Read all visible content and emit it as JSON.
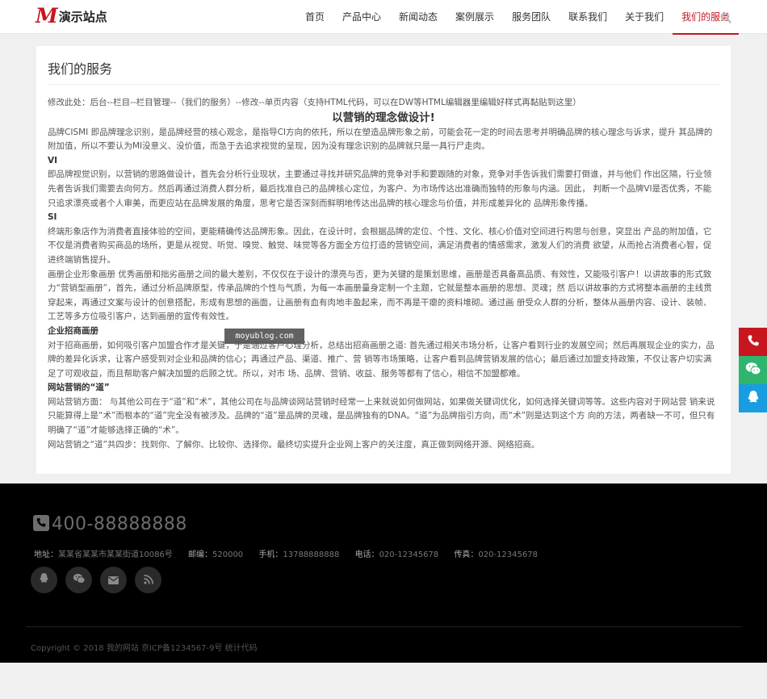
{
  "header": {
    "logo_mark": "M",
    "logo_text": "演示站点",
    "nav": [
      {
        "label": "首页"
      },
      {
        "label": "产品中心"
      },
      {
        "label": "新闻动态"
      },
      {
        "label": "案例展示"
      },
      {
        "label": "服务团队"
      },
      {
        "label": "联系我们"
      },
      {
        "label": "关于我们"
      },
      {
        "label": "我们的服务",
        "active": true
      }
    ]
  },
  "main": {
    "page_title": "我们的服务",
    "hint": "修改此处：后台--栏目--栏目管理--（我们的服务）--修改--单页内容（支持HTML代码，可以在DW等HTML编辑器里编辑好样式再黏贴到这里）",
    "headline": "以营销的理念做设计!",
    "p1": "品牌CISMI 即品牌理念识别，是品牌经营的核心观念，是指导CI方向的依托，所以在塑造品牌形象之前，可能会花一定的时间去思考并明确品牌的核心理念与诉求，提升 其品牌的附加值，所以不要认为MI没意义、没价值，而急于去追求视觉的呈现，因为没有理念识别的品牌就只是一具行尸走肉。",
    "h_vi": "VI",
    "p2": "即品牌视觉识别，以营销的思路做设计，首先会分析行业现状，主要通过寻找并研究品牌的竞争对手和要跟随的对象，竞争对手告诉我们需要打倒谁，并与他们 作出区隔，行业领先者告诉我们需要去向何方。然后再通过消费人群分析，最后找准自己的品牌核心定位，为客户、为市场传达出准确而独特的形象与内涵。因此， 判断一个品牌VI是否优秀，不能只追求漂亮或者个人审美，而更应站在品牌发展的角度，思考它是否深刻而鲜明地传达出品牌的核心理念与价值，并形成差异化的 品牌形象传播。",
    "h_si": "SI",
    "p3": "终端形象店作为消费者直接体验的空间，更能精确传达品牌形象。因此，在设计时，会根据品牌的定位、个性、文化、核心价值对空间进行构思与创意，突显出 产品的附加值，它不仅是消费者购买商品的场所，更是从视觉、听觉、嗅觉、触觉、味觉等各方面全方位打造的营销空间，满足消费者的情感需求，激发人们的消费 欲望，从而抢占消费者心智，促进终端销售提升。",
    "p4": "画册企业形象画册 优秀画册和拙劣画册之间的最大差别，不仅仅在于设计的漂亮与否，更为关键的是策划思维，画册是否具备高品质、有效性，又能吸引客户！以讲故事的形式致力“营销型画册”，首先，通过分析品牌原型，传承品牌的个性与气质，为每一本画册量身定制一个主题，它就是整本画册的思想、灵魂；然 后以讲故事的方式将整本画册的主线贯穿起来，再通过文案与设计的创意搭配，形成有思想的画面，让画册有血有肉地丰盈起来，而不再是干瘪的资料堆砌。通过画 册受众人群的分析，整体从画册内容、设计、装帧、工艺等多方位吸引客户，达到画册的宣传有效性。",
    "h_zs": "企业招商画册",
    "p5": "对于招商画册，如何吸引客户加盟合作才是关键，于是通过客户心理分析，总结出招商画册之道: 首先通过相关市场分析，让客户看到行业的发展空间；然后再展现企业的实力，品牌的差异化诉求，让客户感受到对企业和品牌的信心；再通过产品、渠道、推广、营 销等市场策略，让客户看到品牌营销发展的信心；最后通过加盟支持政策，不仅让客户切实满足了可观收益，而且帮助客户解决加盟的后顾之忧。所以，对市 场、品牌、营销、收益、服务等都有了信心，相信不加盟都难。",
    "h_dao": "网站营销的“道”",
    "p6": "网站营销方面： 与其他公司在于“道”和“术”，其他公司在与品牌谈网站营销时经常一上来就说如何做网站，如果做关键词优化，如何选择关键词等等。这些内容对于网站营 销来说只能算得上是“术”而根本的“道”完全没有被涉及。品牌的“道”是品牌的灵魂，是品牌独有的DNA。“道”为品牌指引方向，而“术”则是达到这个方 向的方法，两者缺一不可，但只有明确了“道”才能够选择正确的“术”。",
    "p7": "网站营销之“道”共四步：找到你、了解你、比较你、选择你。最终切实提升企业网上客户的关注度，真正做到网络开源、网络招商。"
  },
  "watermark": "moyublog.com",
  "float_icons": [
    "phone-icon",
    "wechat-icon",
    "qq-icon"
  ],
  "footer": {
    "hotline": "400-88888888",
    "address_label": "地址：",
    "address": "某某省某某市某某街道10086号",
    "zip_label": "邮编：",
    "zip": "520000",
    "mobile_label": "手机：",
    "mobile": "13788888888",
    "tel_label": "电话：",
    "tel": "020-12345678",
    "fax_label": "传真：",
    "fax": "020-12345678",
    "social_icons": [
      "qq-icon",
      "wechat-icon",
      "email-icon",
      "rss-icon"
    ],
    "copyright": "Copyright © 2018 我的网站 京ICP备1234567-9号 统计代码"
  },
  "colors": {
    "brand_red": "#c8161e",
    "wechat_green": "#2fb56e",
    "qq_blue": "#1a9de0",
    "footer_bg": "#000000"
  }
}
